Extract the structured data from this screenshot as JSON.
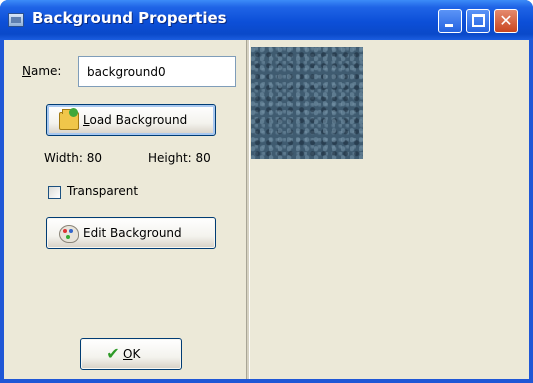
{
  "window": {
    "title": "Background Properties",
    "app_icon": "background-properties-icon",
    "controls": {
      "minimize": "minimize-icon",
      "maximize": "maximize-icon",
      "close": "✕"
    }
  },
  "form": {
    "name_label": "Name:",
    "name_mnemonic": "N",
    "name_rest": "ame:",
    "name_value": "background0",
    "load_button": {
      "label": "Load Background",
      "mnemonic": "L",
      "rest": "oad Background",
      "icon": "folder-open-icon"
    },
    "width_text": "Width: 80",
    "height_text": "Height: 80",
    "transparent": {
      "label": "Transparent",
      "checked": false
    },
    "edit_button": {
      "label": "Edit Background",
      "icon": "palette-icon"
    },
    "ok_button": {
      "label": "OK",
      "mnemonic": "O",
      "rest": "K",
      "icon": "checkmark-icon"
    }
  },
  "preview": {
    "description_icon": "texture-preview"
  },
  "colors": {
    "titlebar": "#0a49c9",
    "client_bg": "#ece9d8",
    "texture": "#3f5b70"
  }
}
